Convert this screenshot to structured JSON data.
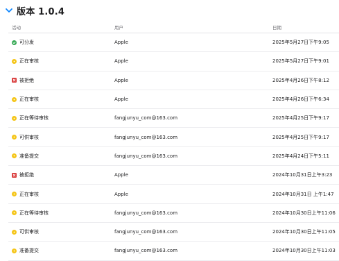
{
  "header": {
    "title": "版本 1.0.4"
  },
  "columns": {
    "activity": "活动",
    "user": "用户",
    "date": "日期"
  },
  "colors": {
    "green": "#34a853",
    "yellow": "#f5c518",
    "red": "#d93a3a"
  },
  "rows": [
    {
      "status": "green-check-icon",
      "activity": "可分发",
      "user": "Apple",
      "date": "2025年5月27日下午9:05"
    },
    {
      "status": "yellow-dot-icon",
      "activity": "正在审核",
      "user": "Apple",
      "date": "2025年5月27日下午9:01"
    },
    {
      "status": "red-x-icon",
      "activity": "被拒绝",
      "user": "Apple",
      "date": "2025年4月26日下午8:12"
    },
    {
      "status": "yellow-dot-icon",
      "activity": "正在审核",
      "user": "Apple",
      "date": "2025年4月26日下午6:34"
    },
    {
      "status": "yellow-dot-icon",
      "activity": "正在等待审核",
      "user": "fangjunyu_com@163.com",
      "date": "2025年4月25日下午9:17"
    },
    {
      "status": "yellow-dot-icon",
      "activity": "可供审核",
      "user": "fangjunyu_com@163.com",
      "date": "2025年4月25日下午9:17"
    },
    {
      "status": "yellow-dot-icon",
      "activity": "准备提交",
      "user": "fangjunyu_com@163.com",
      "date": "2025年4月24日下午5:11"
    },
    {
      "status": "red-x-icon",
      "activity": "被拒绝",
      "user": "Apple",
      "date": "2024年10月31日上午3:23"
    },
    {
      "status": "yellow-dot-icon",
      "activity": "正在审核",
      "user": "Apple",
      "date": "2024年10月31日 上午1:47"
    },
    {
      "status": "yellow-dot-icon",
      "activity": "正在等待审核",
      "user": "fangjunyu_com@163.com",
      "date": "2024年10月30日上午11:06"
    },
    {
      "status": "yellow-dot-icon",
      "activity": "可供审核",
      "user": "fangjunyu_com@163.com",
      "date": "2024年10月30日上午11:05"
    },
    {
      "status": "yellow-dot-icon",
      "activity": "准备提交",
      "user": "fangjunyu_com@163.com",
      "date": "2024年10月30日上午11:03"
    }
  ]
}
